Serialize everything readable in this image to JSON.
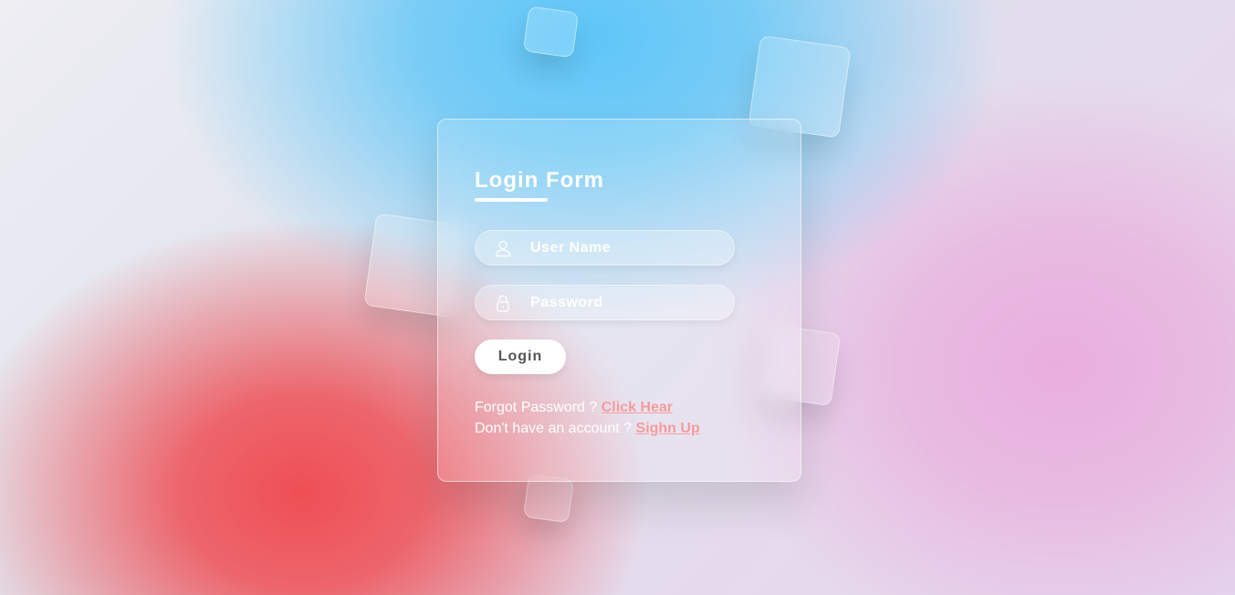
{
  "form": {
    "title": "Login Form",
    "username": {
      "placeholder": "User Name",
      "value": ""
    },
    "password": {
      "placeholder": "Password",
      "value": ""
    },
    "login_label": "Login",
    "forgot_text": "Forgot Password ?",
    "forgot_link": "Click Hear",
    "signup_text": "Don't have an account ?",
    "signup_link": "Sighn Up"
  },
  "icons": {
    "username": "user-icon",
    "password": "lock-icon"
  },
  "colors": {
    "link": "#f39a9a",
    "accent_red": "#ef4f55",
    "accent_blue": "#5ec6f8",
    "accent_pink": "#e9aedd"
  }
}
